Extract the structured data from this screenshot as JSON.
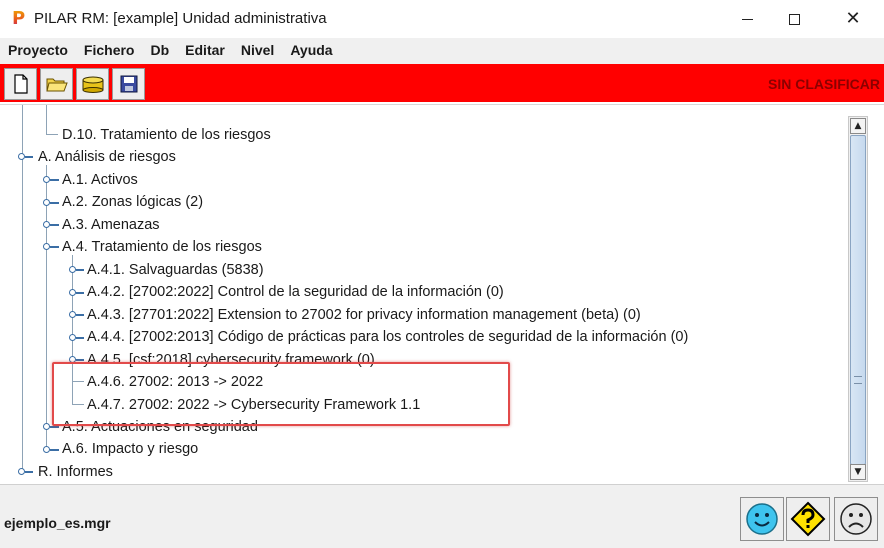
{
  "window": {
    "logo": "P",
    "title": "PILAR RM: [example] Unidad administrativa",
    "close_glyph": "✕"
  },
  "menubar": {
    "items": [
      "Proyecto",
      "Fichero",
      "Db",
      "Editar",
      "Nivel",
      "Ayuda"
    ]
  },
  "toolbar": {
    "buttons": [
      "new-document-icon",
      "open-folder-icon",
      "database-icon",
      "save-disk-icon"
    ],
    "classification": "SIN CLASIFICAR",
    "bar_color": "#ff0000"
  },
  "tree": {
    "nodes": [
      {
        "label": "D.10. Tratamiento de los riesgos",
        "level": 2
      },
      {
        "label": "A. Análisis de riesgos",
        "level": 0
      },
      {
        "label": "A.1. Activos",
        "level": 1
      },
      {
        "label": "A.2. Zonas lógicas (2)",
        "level": 1
      },
      {
        "label": "A.3. Amenazas",
        "level": 1
      },
      {
        "label": "A.4. Tratamiento de los riesgos",
        "level": 1
      },
      {
        "label": "A.4.1. Salvaguardas (5838)",
        "level": 2
      },
      {
        "label": "A.4.2. [27002:2022] Control de la seguridad de la información (0)",
        "level": 2
      },
      {
        "label": "A.4.3. [27701:2022] Extension to 27002 for privacy information management (beta) (0)",
        "level": 2
      },
      {
        "label": "A.4.4. [27002:2013] Código de prácticas para los controles de seguridad de la información (0)",
        "level": 2
      },
      {
        "label": "A.4.5. [csf:2018] cybersecurity framework (0)",
        "level": 2
      },
      {
        "label": "A.4.6. 27002: 2013 -> 2022",
        "level": 2
      },
      {
        "label": "A.4.7. 27002: 2022 -> Cybersecurity Framework 1.1",
        "level": 2
      },
      {
        "label": "A.5. Actuaciones en seguridad",
        "level": 1
      },
      {
        "label": "A.6. Impacto y riesgo",
        "level": 1
      },
      {
        "label": "R. Informes",
        "level": 0
      }
    ],
    "highlight_color": "#e24a4a"
  },
  "scrollbar": {
    "up_glyph": "▲",
    "down_glyph": "▼"
  },
  "statusbar": {
    "filename": "ejemplo_es.mgr",
    "faces": [
      "smiley-happy-icon",
      "question-warning-icon",
      "smiley-sad-icon"
    ]
  }
}
